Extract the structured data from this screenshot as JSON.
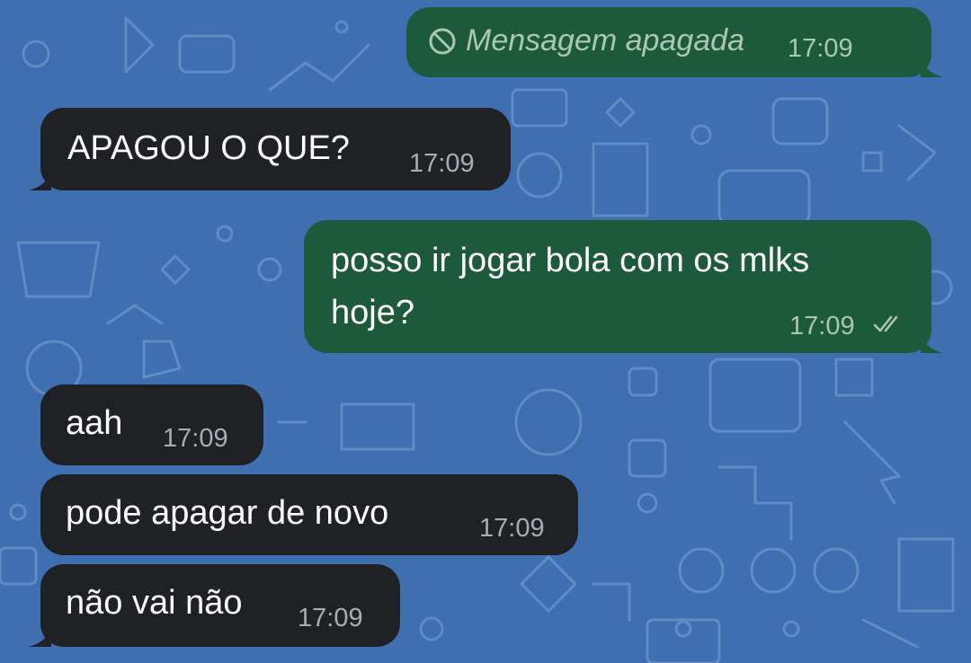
{
  "chat": {
    "messages": [
      {
        "id": "m1",
        "direction": "outgoing",
        "deleted": true,
        "text": "Mensagem apagada",
        "time": "17:09",
        "deleted_icon": "prohibited-icon"
      },
      {
        "id": "m2",
        "direction": "incoming",
        "text": "APAGOU O QUE?",
        "time": "17:09"
      },
      {
        "id": "m3",
        "direction": "outgoing",
        "text_line1": "posso ir jogar bola com os mlks",
        "text_line2": "hoje?",
        "time": "17:09",
        "status": "read",
        "status_icon": "double-check-icon"
      },
      {
        "id": "m4",
        "direction": "incoming",
        "text": "aah",
        "time": "17:09"
      },
      {
        "id": "m5",
        "direction": "incoming",
        "text": "pode apagar de novo",
        "time": "17:09"
      },
      {
        "id": "m6",
        "direction": "incoming",
        "text": "não vai não",
        "time": "17:09"
      }
    ]
  },
  "colors": {
    "background": "#3f6fb0",
    "incoming_bubble": "#1f2124",
    "outgoing_bubble": "#1d5a3b"
  }
}
